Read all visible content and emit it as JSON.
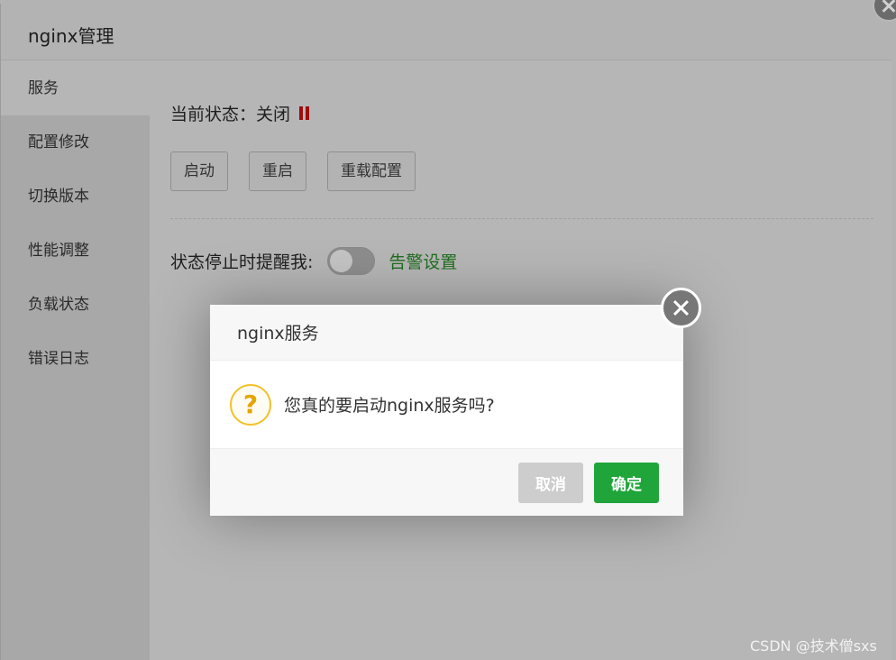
{
  "panel": {
    "title": "nginx管理",
    "sidebar": [
      {
        "label": "服务",
        "active": true
      },
      {
        "label": "配置修改"
      },
      {
        "label": "切换版本"
      },
      {
        "label": "性能调整"
      },
      {
        "label": "负载状态"
      },
      {
        "label": "错误日志"
      }
    ],
    "status_label": "当前状态：关闭",
    "buttons": {
      "start": "启动",
      "restart": "重启",
      "reload": "重载配置"
    },
    "alert_label": "状态停止时提醒我:",
    "alert_toggle_on": false,
    "alert_link": "告警设置"
  },
  "dialog": {
    "title": "nginx服务",
    "message": "您真的要启动nginx服务吗?",
    "icon": "?",
    "cancel": "取消",
    "confirm": "确定"
  },
  "watermark": "CSDN @技术僧sxs",
  "colors": {
    "confirm": "#20a53a",
    "link": "#1f6d1f",
    "stopped": "#9d0b0b"
  }
}
